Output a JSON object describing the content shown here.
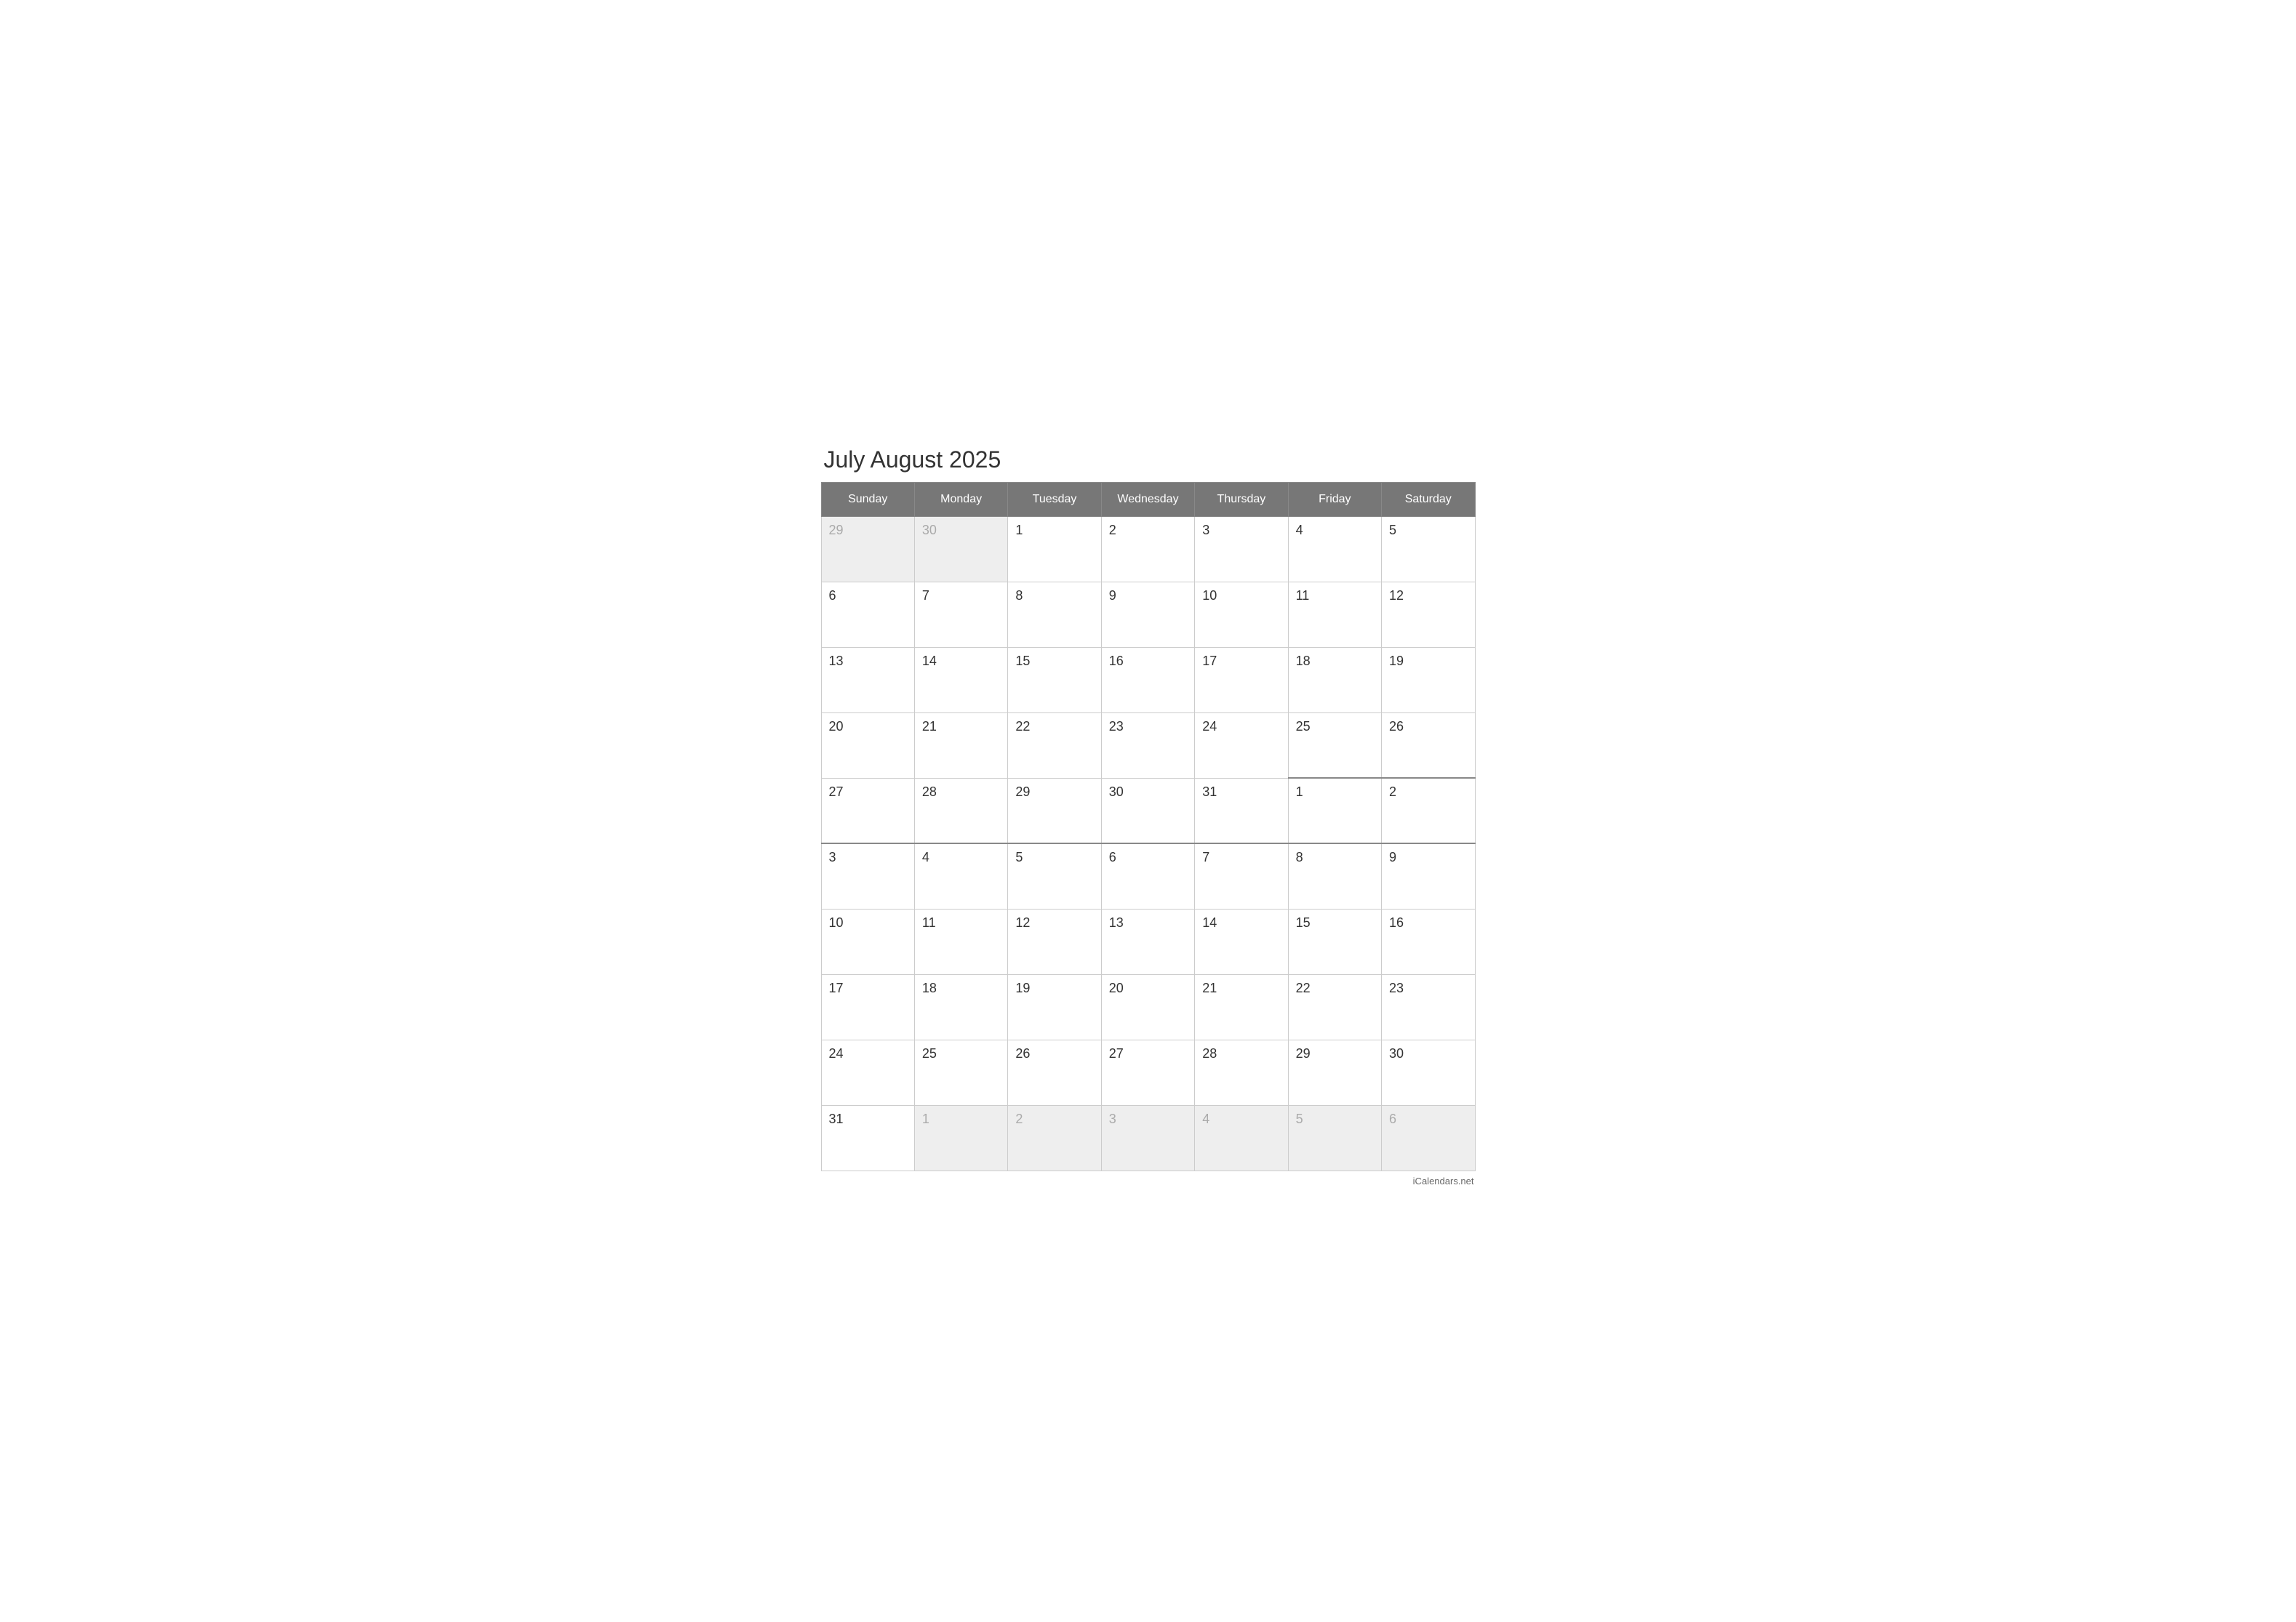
{
  "title": "July August 2025",
  "days_of_week": [
    "Sunday",
    "Monday",
    "Tuesday",
    "Wednesday",
    "Thursday",
    "Friday",
    "Saturday"
  ],
  "weeks": [
    [
      {
        "day": "29",
        "out_of_month": true
      },
      {
        "day": "30",
        "out_of_month": true
      },
      {
        "day": "1",
        "out_of_month": false
      },
      {
        "day": "2",
        "out_of_month": false
      },
      {
        "day": "3",
        "out_of_month": false
      },
      {
        "day": "4",
        "out_of_month": false
      },
      {
        "day": "5",
        "out_of_month": false
      }
    ],
    [
      {
        "day": "6",
        "out_of_month": false
      },
      {
        "day": "7",
        "out_of_month": false
      },
      {
        "day": "8",
        "out_of_month": false
      },
      {
        "day": "9",
        "out_of_month": false
      },
      {
        "day": "10",
        "out_of_month": false
      },
      {
        "day": "11",
        "out_of_month": false
      },
      {
        "day": "12",
        "out_of_month": false
      }
    ],
    [
      {
        "day": "13",
        "out_of_month": false
      },
      {
        "day": "14",
        "out_of_month": false
      },
      {
        "day": "15",
        "out_of_month": false
      },
      {
        "day": "16",
        "out_of_month": false
      },
      {
        "day": "17",
        "out_of_month": false
      },
      {
        "day": "18",
        "out_of_month": false
      },
      {
        "day": "19",
        "out_of_month": false
      }
    ],
    [
      {
        "day": "20",
        "out_of_month": false
      },
      {
        "day": "21",
        "out_of_month": false
      },
      {
        "day": "22",
        "out_of_month": false
      },
      {
        "day": "23",
        "out_of_month": false
      },
      {
        "day": "24",
        "out_of_month": false
      },
      {
        "day": "25",
        "out_of_month": false
      },
      {
        "day": "26",
        "out_of_month": false
      }
    ],
    [
      {
        "day": "27",
        "out_of_month": false
      },
      {
        "day": "28",
        "out_of_month": false
      },
      {
        "day": "29",
        "out_of_month": false
      },
      {
        "day": "30",
        "out_of_month": false
      },
      {
        "day": "31",
        "out_of_month": false
      },
      {
        "day": "1",
        "out_of_month": false,
        "month_transition": true
      },
      {
        "day": "2",
        "out_of_month": false,
        "month_transition": true
      }
    ],
    [
      {
        "day": "3",
        "out_of_month": false,
        "month_transition": true
      },
      {
        "day": "4",
        "out_of_month": false,
        "month_transition": true
      },
      {
        "day": "5",
        "out_of_month": false,
        "month_transition": true
      },
      {
        "day": "6",
        "out_of_month": false,
        "month_transition": true
      },
      {
        "day": "7",
        "out_of_month": false,
        "month_transition": true
      },
      {
        "day": "8",
        "out_of_month": false,
        "month_transition": true
      },
      {
        "day": "9",
        "out_of_month": false,
        "month_transition": true
      }
    ],
    [
      {
        "day": "10",
        "out_of_month": false
      },
      {
        "day": "11",
        "out_of_month": false
      },
      {
        "day": "12",
        "out_of_month": false
      },
      {
        "day": "13",
        "out_of_month": false
      },
      {
        "day": "14",
        "out_of_month": false
      },
      {
        "day": "15",
        "out_of_month": false
      },
      {
        "day": "16",
        "out_of_month": false
      }
    ],
    [
      {
        "day": "17",
        "out_of_month": false
      },
      {
        "day": "18",
        "out_of_month": false
      },
      {
        "day": "19",
        "out_of_month": false
      },
      {
        "day": "20",
        "out_of_month": false
      },
      {
        "day": "21",
        "out_of_month": false
      },
      {
        "day": "22",
        "out_of_month": false
      },
      {
        "day": "23",
        "out_of_month": false
      }
    ],
    [
      {
        "day": "24",
        "out_of_month": false
      },
      {
        "day": "25",
        "out_of_month": false
      },
      {
        "day": "26",
        "out_of_month": false
      },
      {
        "day": "27",
        "out_of_month": false
      },
      {
        "day": "28",
        "out_of_month": false
      },
      {
        "day": "29",
        "out_of_month": false
      },
      {
        "day": "30",
        "out_of_month": false
      }
    ],
    [
      {
        "day": "31",
        "out_of_month": false
      },
      {
        "day": "1",
        "out_of_month": true
      },
      {
        "day": "2",
        "out_of_month": true
      },
      {
        "day": "3",
        "out_of_month": true
      },
      {
        "day": "4",
        "out_of_month": true
      },
      {
        "day": "5",
        "out_of_month": true
      },
      {
        "day": "6",
        "out_of_month": true
      }
    ]
  ],
  "footer": "iCalendars.net"
}
